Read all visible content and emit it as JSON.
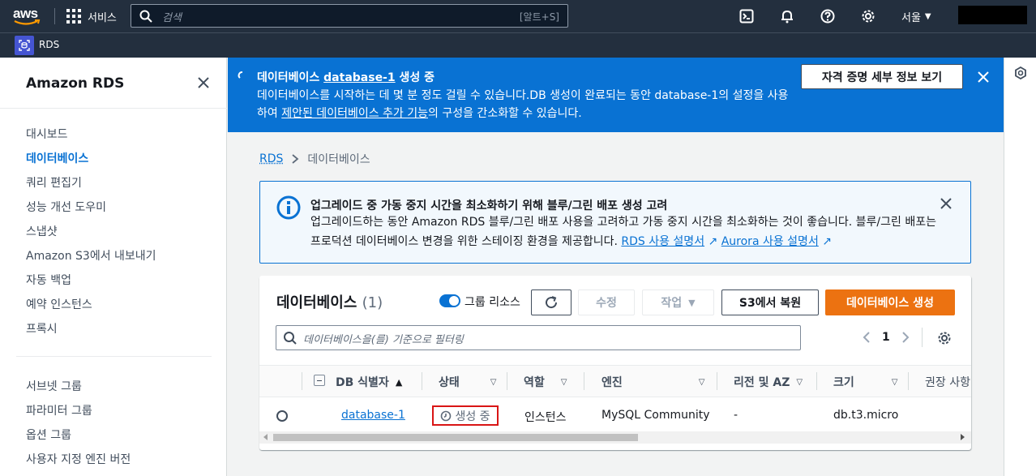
{
  "topnav": {
    "logo_text": "aws",
    "services_label": "서비스",
    "search_placeholder": "검색",
    "search_shortcut": "[알트+S]",
    "region_label": "서울"
  },
  "subnav": {
    "service_label": "RDS"
  },
  "sidebar": {
    "title": "Amazon RDS",
    "items": [
      {
        "label": "대시보드"
      },
      {
        "label": "데이터베이스",
        "active": true
      },
      {
        "label": "쿼리 편집기"
      },
      {
        "label": "성능 개선 도우미"
      },
      {
        "label": "스냅샷"
      },
      {
        "label": "Amazon S3에서 내보내기"
      },
      {
        "label": "자동 백업"
      },
      {
        "label": "예약 인스턴스"
      },
      {
        "label": "프록시"
      },
      {
        "label": "서브넷 그룹"
      },
      {
        "label": "파라미터 그룹"
      },
      {
        "label": "옵션 그룹"
      },
      {
        "label": "사용자 지정 엔진 버전"
      }
    ]
  },
  "flash": {
    "title_pre": "데이터베이스 ",
    "title_db": "database-1",
    "title_post": " 생성 중",
    "body_1": "데이터베이스를 시작하는 데 몇 분 정도 걸릴 수 있습니다.DB 생성이 완료되는 동안 database-1의 설정을 사용하여 ",
    "body_link": "제안된 데이터베이스 추가 기능",
    "body_2": "의 구성을 간소화할 수 있습니다.",
    "button_label": "자격 증명 세부 정보 보기"
  },
  "breadcrumb": {
    "root": "RDS",
    "current": "데이터베이스"
  },
  "info": {
    "title": "업그레이드 중 가동 중지 시간을 최소화하기 위해 블루/그린 배포 생성 고려",
    "body": "업그레이드하는 동안 Amazon RDS 블루/그린 배포 사용을 고려하고 가동 중지 시간을 최소화하는 것이 좋습니다. 블루/그린 배포는 프로덕션 데이터베이스 변경을 위한 스테이징 환경을 제공합니다. ",
    "link1": "RDS 사용 설명서",
    "link2": "Aurora 사용 설명서"
  },
  "databases": {
    "title": "데이터베이스",
    "count": "(1)",
    "group_toggle_label": "그룹 리소스",
    "modify_label": "수정",
    "actions_label": "작업",
    "restore_s3_label": "S3에서 복원",
    "create_label": "데이터베이스 생성",
    "filter_placeholder": "데이터베이스을(를) 기준으로 필터링",
    "page": "1",
    "columns": [
      "DB 식별자",
      "상태",
      "역할",
      "엔진",
      "리전 및 AZ",
      "크기",
      "권장 사항"
    ],
    "rows": [
      {
        "id": "database-1",
        "status": "생성 중",
        "role": "인스턴스",
        "engine": "MySQL Community",
        "region_az": "-",
        "size": "db.t3.micro"
      }
    ]
  },
  "colors": {
    "nav_bg": "#232f3e",
    "flash_bg": "#0972d3",
    "primary_button": "#ec7211",
    "link": "#0972d3",
    "status_highlight": "#d91515"
  }
}
